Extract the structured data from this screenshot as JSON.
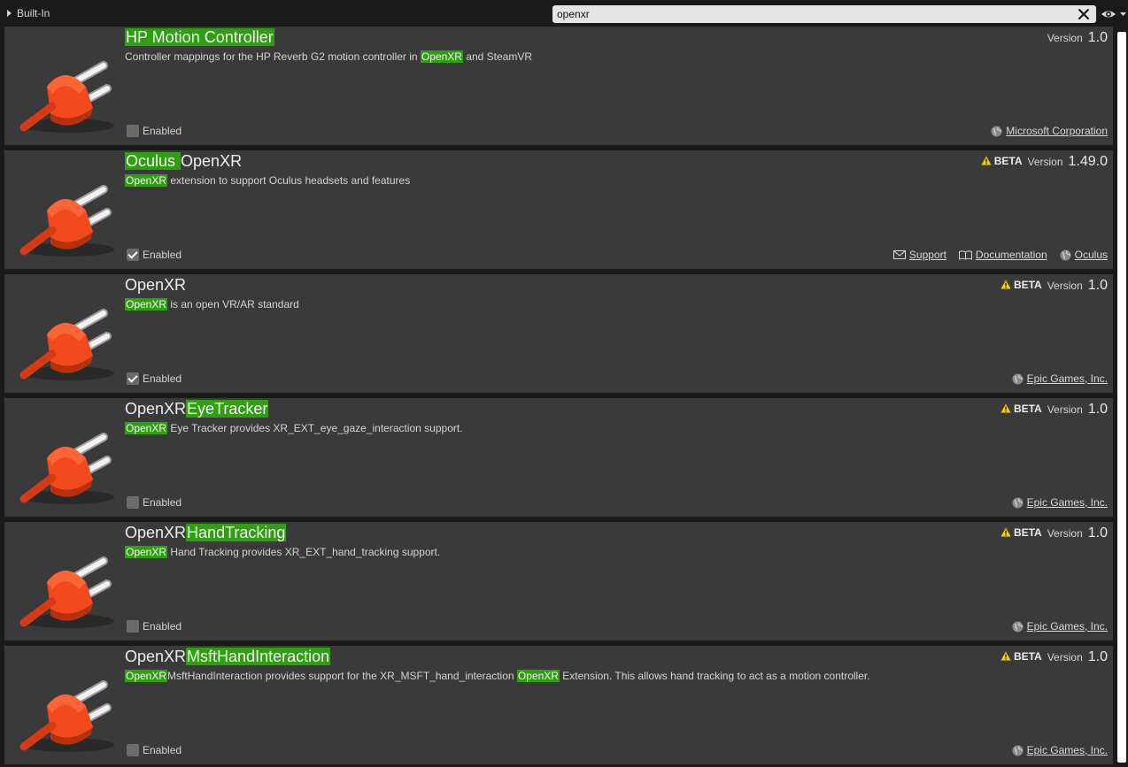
{
  "category": {
    "label": "Built-In"
  },
  "search": {
    "value": "openxr"
  },
  "icons": {
    "plugin": "plug-icon",
    "clear": "close-icon",
    "view": "eye-icon",
    "beta": "warning-icon",
    "web": "globe-icon",
    "support": "envelope-icon",
    "docs": "book-icon"
  },
  "plugins": [
    {
      "title": [
        "",
        "HP Motion Controller"
      ],
      "desc": [
        "Controller mappings for the HP Reverb G2 motion controller in ",
        "OpenXR",
        " and SteamVR"
      ],
      "beta": "",
      "version_label": "Version",
      "version": "1.0",
      "enabled_label": "Enabled",
      "enabled": false,
      "support": "",
      "documentation": "",
      "vendor": "Microsoft Corporation"
    },
    {
      "title": [
        "",
        "Oculus ",
        "OpenXR"
      ],
      "desc": [
        "",
        "OpenXR",
        " extension to support Oculus headsets and features"
      ],
      "beta": "BETA",
      "version_label": "Version",
      "version": "1.49.0",
      "enabled_label": "Enabled",
      "enabled": true,
      "support": "Support",
      "documentation": "Documentation",
      "vendor": "Oculus"
    },
    {
      "title": [
        "",
        "",
        "OpenXR"
      ],
      "desc": [
        "",
        "OpenXR",
        " is an open VR/AR standard"
      ],
      "beta": "BETA",
      "version_label": "Version",
      "version": "1.0",
      "enabled_label": "Enabled",
      "enabled": true,
      "support": "",
      "documentation": "",
      "vendor": "Epic Games, Inc."
    },
    {
      "title": [
        "",
        "",
        "OpenXR",
        "EyeTracker"
      ],
      "desc": [
        "",
        "OpenXR",
        " Eye Tracker provides XR_EXT_eye_gaze_interaction support."
      ],
      "beta": "BETA",
      "version_label": "Version",
      "version": "1.0",
      "enabled_label": "Enabled",
      "enabled": false,
      "support": "",
      "documentation": "",
      "vendor": "Epic Games, Inc."
    },
    {
      "title": [
        "",
        "",
        "OpenXR",
        "HandTracking"
      ],
      "desc": [
        "",
        "OpenXR",
        " Hand Tracking provides XR_EXT_hand_tracking support."
      ],
      "beta": "BETA",
      "version_label": "Version",
      "version": "1.0",
      "enabled_label": "Enabled",
      "enabled": false,
      "support": "",
      "documentation": "",
      "vendor": "Epic Games, Inc."
    },
    {
      "title": [
        "",
        "",
        "OpenXR",
        "MsftHandInteraction"
      ],
      "desc": [
        "",
        "OpenXR",
        "MsftHandInteraction provides support for the XR_MSFT_hand_interaction ",
        "OpenXR",
        " Extension.  This allows hand tracking to act as a motion controller."
      ],
      "beta": "BETA",
      "version_label": "Version",
      "version": "1.0",
      "enabled_label": "Enabled",
      "enabled": false,
      "support": "",
      "documentation": "",
      "vendor": "Epic Games, Inc."
    }
  ],
  "colors": {
    "highlight": "#2f9e11",
    "card": "#3a3a3a",
    "background": "#1a1a1a",
    "plug": "#f24a1e"
  }
}
